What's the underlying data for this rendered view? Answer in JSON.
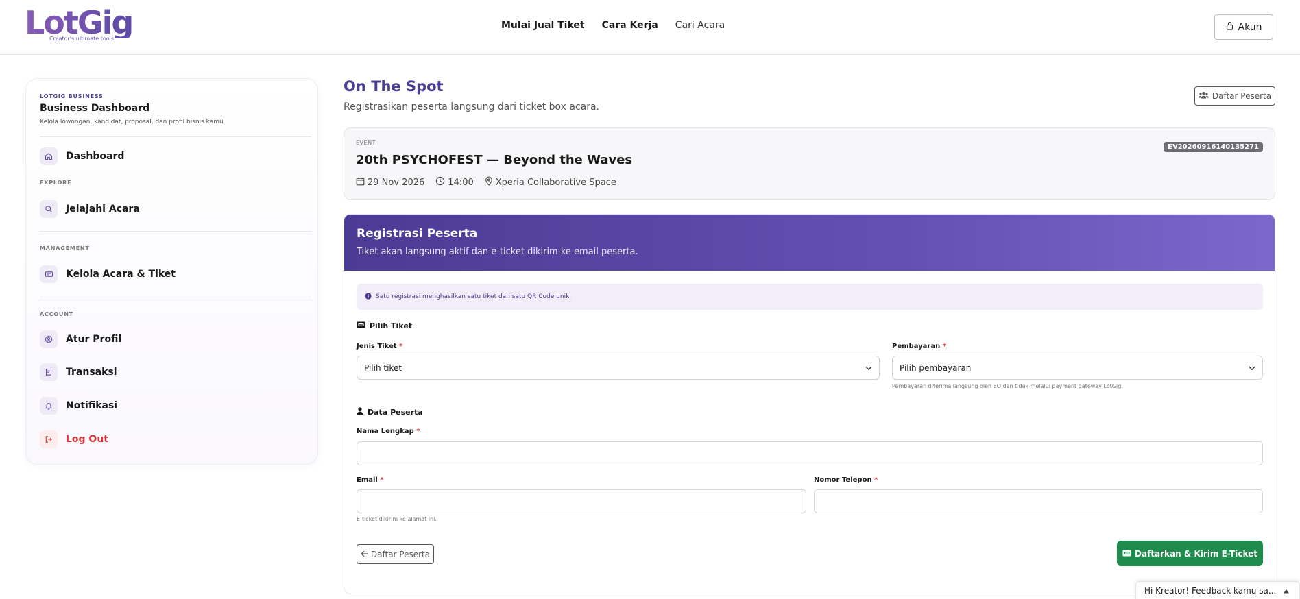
{
  "header": {
    "logo_text": "LotGig",
    "logo_tagline": "Creator's ultimate tools",
    "nav": [
      {
        "label": "Mulai Jual Tiket"
      },
      {
        "label": "Cara Kerja"
      },
      {
        "label": "Cari Acara"
      }
    ],
    "account_label": "Akun"
  },
  "sidebar": {
    "kicker": "LOTGIG BUSINESS",
    "title": "Business Dashboard",
    "description": "Kelola lowongan, kandidat, proposal, dan profil bisnis kamu.",
    "dashboard_label": "Dashboard",
    "sections": {
      "explore": "EXPLORE",
      "management": "MANAGEMENT",
      "account": "ACCOUNT"
    },
    "items": {
      "explore": "Jelajahi Acara",
      "manage": "Kelola Acara & Tiket",
      "profile": "Atur Profil",
      "transactions": "Transaksi",
      "notifications": "Notifikasi",
      "logout": "Log Out"
    },
    "logout_color": "#d23a3a"
  },
  "main": {
    "title": "On The Spot",
    "subtitle": "Registrasikan peserta langsung dari ticket box acara.",
    "participants_button": "Daftar Peserta",
    "event": {
      "kicker": "EVENT",
      "title": "20th PSYCHOFEST — Beyond the Waves",
      "date": "29 Nov 2026",
      "time": "14:00",
      "venue": "Xperia Collaborative Space",
      "code": "EV20260916140135271"
    },
    "registration": {
      "title": "Registrasi Peserta",
      "subtitle": "Tiket akan langsung aktif dan e-ticket dikirim ke email peserta.",
      "info": "Satu registrasi menghasilkan satu tiket dan satu QR Code unik.",
      "ticket_section": "Pilih Tiket",
      "ticket_type_label": "Jenis Tiket",
      "ticket_type_value": "Pilih tiket",
      "payment_label": "Pembayaran",
      "payment_value": "Pilih pembayaran",
      "payment_hint": "Pembayaran diterima langsung oleh EO dan tidak melalui payment gateway LotGig.",
      "participant_section": "Data Peserta",
      "full_name_label": "Nama Lengkap",
      "full_name_value": "",
      "email_label": "Email",
      "email_value": "",
      "email_hint": "E-ticket dikirim ke alamat ini.",
      "phone_label": "Nomor Telepon",
      "phone_value": "",
      "required_mark": "*",
      "back_button": "Daftar Peserta",
      "submit_button": "Daftarkan & Kirim E-Ticket"
    },
    "colors": {
      "brand_purple": "#4b3c8f",
      "submit_green": "#1f8b4c"
    }
  },
  "feedback": {
    "label": "Hi Kreator! Feedback kamu sa..."
  }
}
